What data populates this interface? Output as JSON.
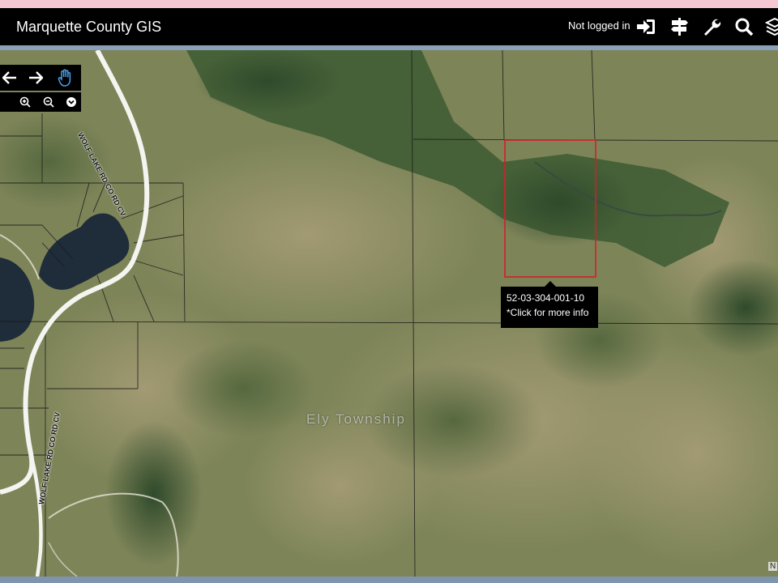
{
  "app": {
    "title": "Marquette County GIS"
  },
  "header": {
    "login_status": "Not logged in"
  },
  "icons": {
    "login": "login-icon",
    "directions": "signpost-icon",
    "tools": "wrench-icon",
    "search": "search-icon",
    "layers": "layers-icon"
  },
  "nav": {
    "back": "arrow-left-icon",
    "forward": "arrow-right-icon",
    "pan": "hand-icon",
    "zoom_in": "zoom-in-icon",
    "zoom_out": "zoom-out-icon",
    "more": "chevron-down-icon"
  },
  "map": {
    "township_label": "Ely Township",
    "road_labels": [
      "WOLF LAKE RD CO RD CV",
      "WOLF LAKE RD CO RD CV"
    ],
    "attribution": "N"
  },
  "parcel_tooltip": {
    "parcel_id": "52-03-304-001-10",
    "hint": "*Click for more info"
  },
  "colors": {
    "header_bg": "#000000",
    "selection_outline": "#d0202a",
    "water": "#1f2c3a"
  }
}
